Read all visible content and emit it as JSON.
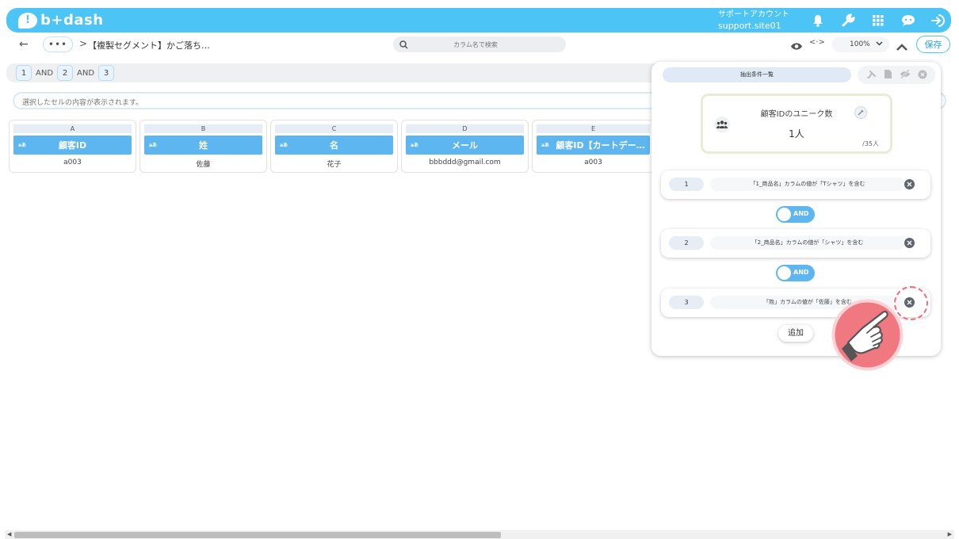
{
  "header": {
    "logo_text": "b+dash",
    "account_label": "サポートアカウント",
    "account_site": "support.site01"
  },
  "toolbar": {
    "back": "←",
    "more": "•••",
    "breadcrumb_sep": ">",
    "breadcrumb": "【複製セグメント】かご落ち…",
    "search_placeholder": "カラム名で検索",
    "code_toggle": "<·>",
    "zoom": "100%",
    "save_label": "保存"
  },
  "conditions_bar": {
    "items": [
      "1",
      "AND",
      "2",
      "AND",
      "3"
    ]
  },
  "cell_bar": {
    "placeholder": "選択したセルの内容が表示されます。"
  },
  "columns": [
    {
      "letter": "A",
      "type": "aあ",
      "name": "顧客ID",
      "value": "a003"
    },
    {
      "letter": "B",
      "type": "aあ",
      "name": "姓",
      "value": "佐藤"
    },
    {
      "letter": "C",
      "type": "aあ",
      "name": "名",
      "value": "花子"
    },
    {
      "letter": "D",
      "type": "aあ",
      "name": "メール",
      "value": "bbbddd@gmail.com"
    },
    {
      "letter": "E",
      "type": "aあ",
      "name": "顧客ID【カートデー…",
      "value": "a003"
    }
  ],
  "panel": {
    "tab_label": "抽出条件一覧",
    "unique_title": "顧客IDのユニーク数",
    "unique_count": "1人",
    "unique_total": "/35人",
    "conditions": [
      {
        "num": "1",
        "text": "「1_商品名」カラムの値が「Tシャツ」を含む"
      },
      {
        "num": "2",
        "text": "「2_商品名」カラムの値が「シャツ」を含む"
      },
      {
        "num": "3",
        "text": "「姓」カラムの値が「佐藤」を含む"
      }
    ],
    "and_label": "AND",
    "add_label": "追加"
  },
  "colors": {
    "accent": "#4cc4f5",
    "column_header": "#5db6f0",
    "highlight": "#ef6d78"
  }
}
